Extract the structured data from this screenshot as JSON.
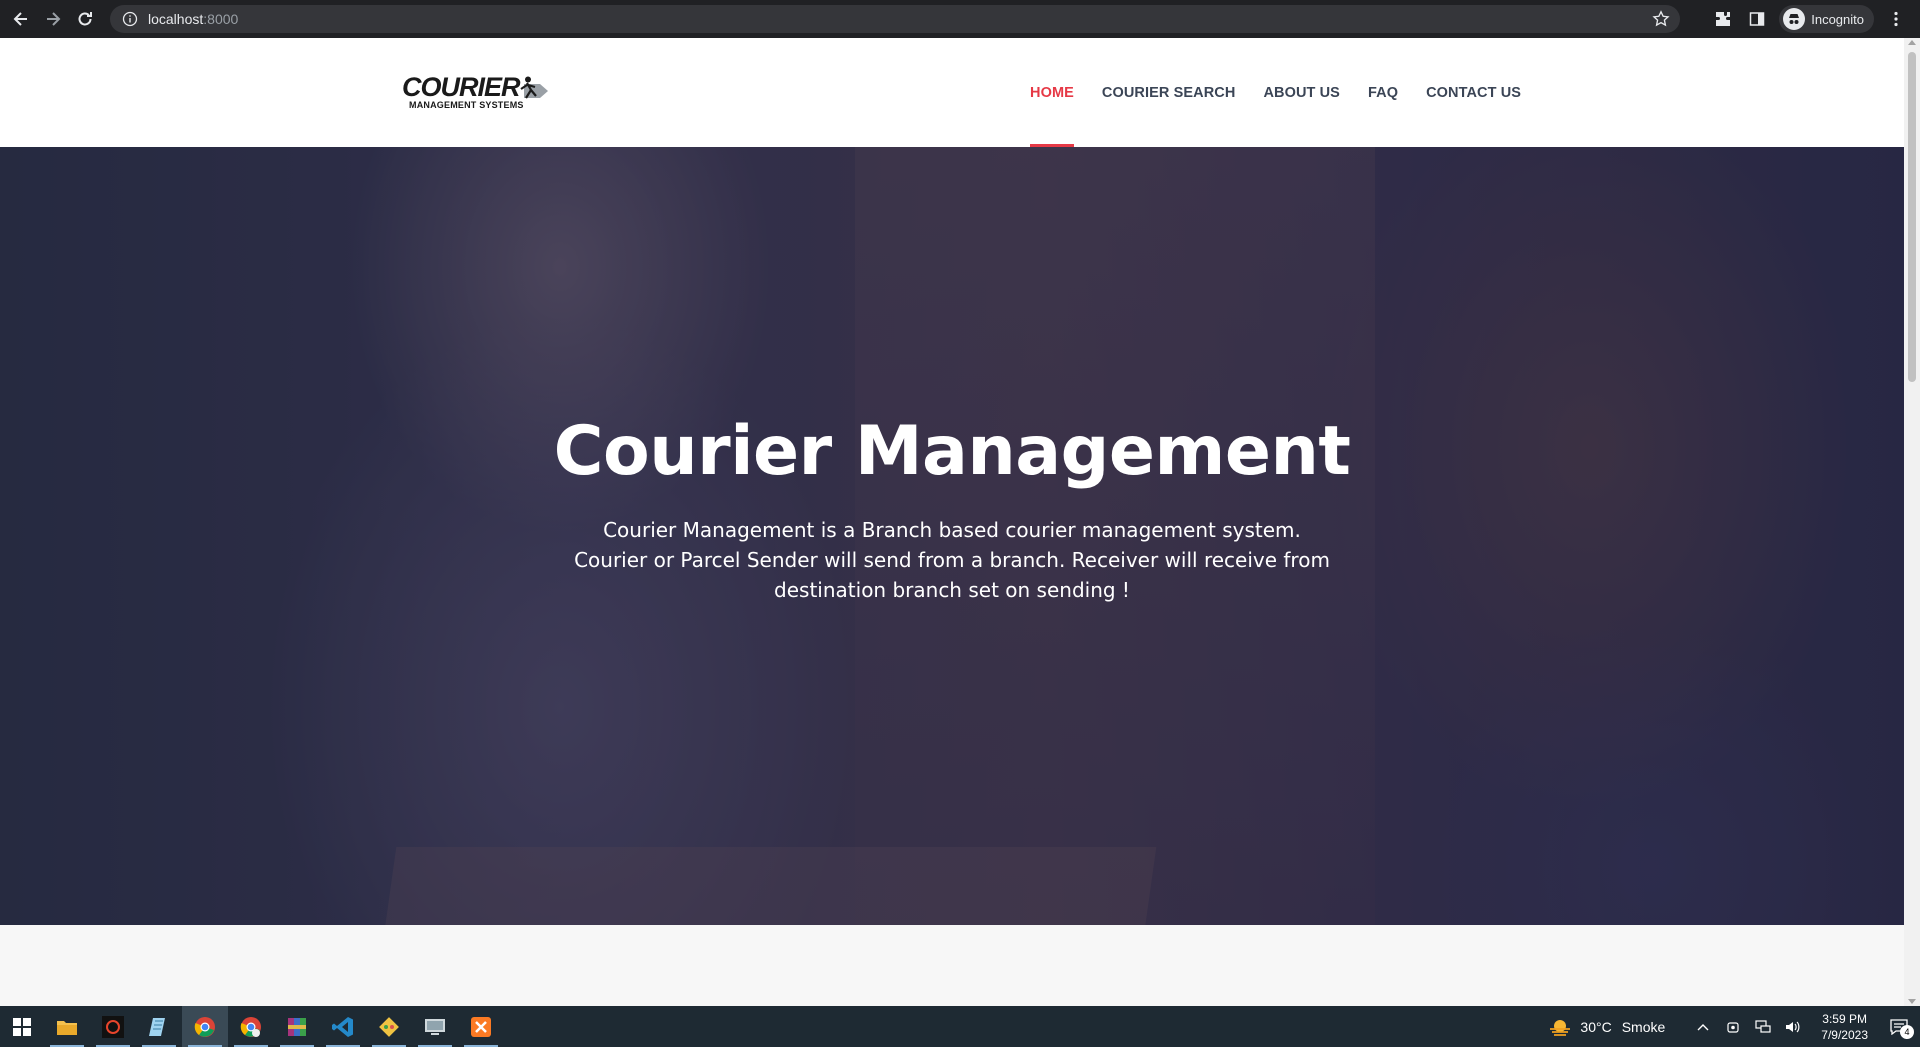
{
  "browser": {
    "url_host": "localhost",
    "url_port": ":8000",
    "profile_label": "Incognito"
  },
  "site": {
    "logo_text": "COURIER",
    "logo_subtext": "MANAGEMENT SYSTEMS",
    "nav": [
      {
        "label": "HOME",
        "active": true
      },
      {
        "label": "COURIER SEARCH",
        "active": false
      },
      {
        "label": "ABOUT US",
        "active": false
      },
      {
        "label": "FAQ",
        "active": false
      },
      {
        "label": "CONTACT US",
        "active": false
      }
    ],
    "accent_color": "#e63946"
  },
  "hero": {
    "title": "Courier Management",
    "description": "Courier Management is a Branch based courier management system. Courier or Parcel Sender will send from a branch. Receiver will receive from destination branch set on sending !"
  },
  "taskbar": {
    "apps": [
      "file-explorer",
      "ryzen-master",
      "notepad",
      "chrome",
      "chrome-profile",
      "winrar",
      "vs-code",
      "git-gui",
      "remote-desktop",
      "xampp"
    ],
    "weather_temp": "30°C",
    "weather_condition": "Smoke",
    "time": "3:59 PM",
    "date": "7/9/2023",
    "notification_count": "4"
  }
}
